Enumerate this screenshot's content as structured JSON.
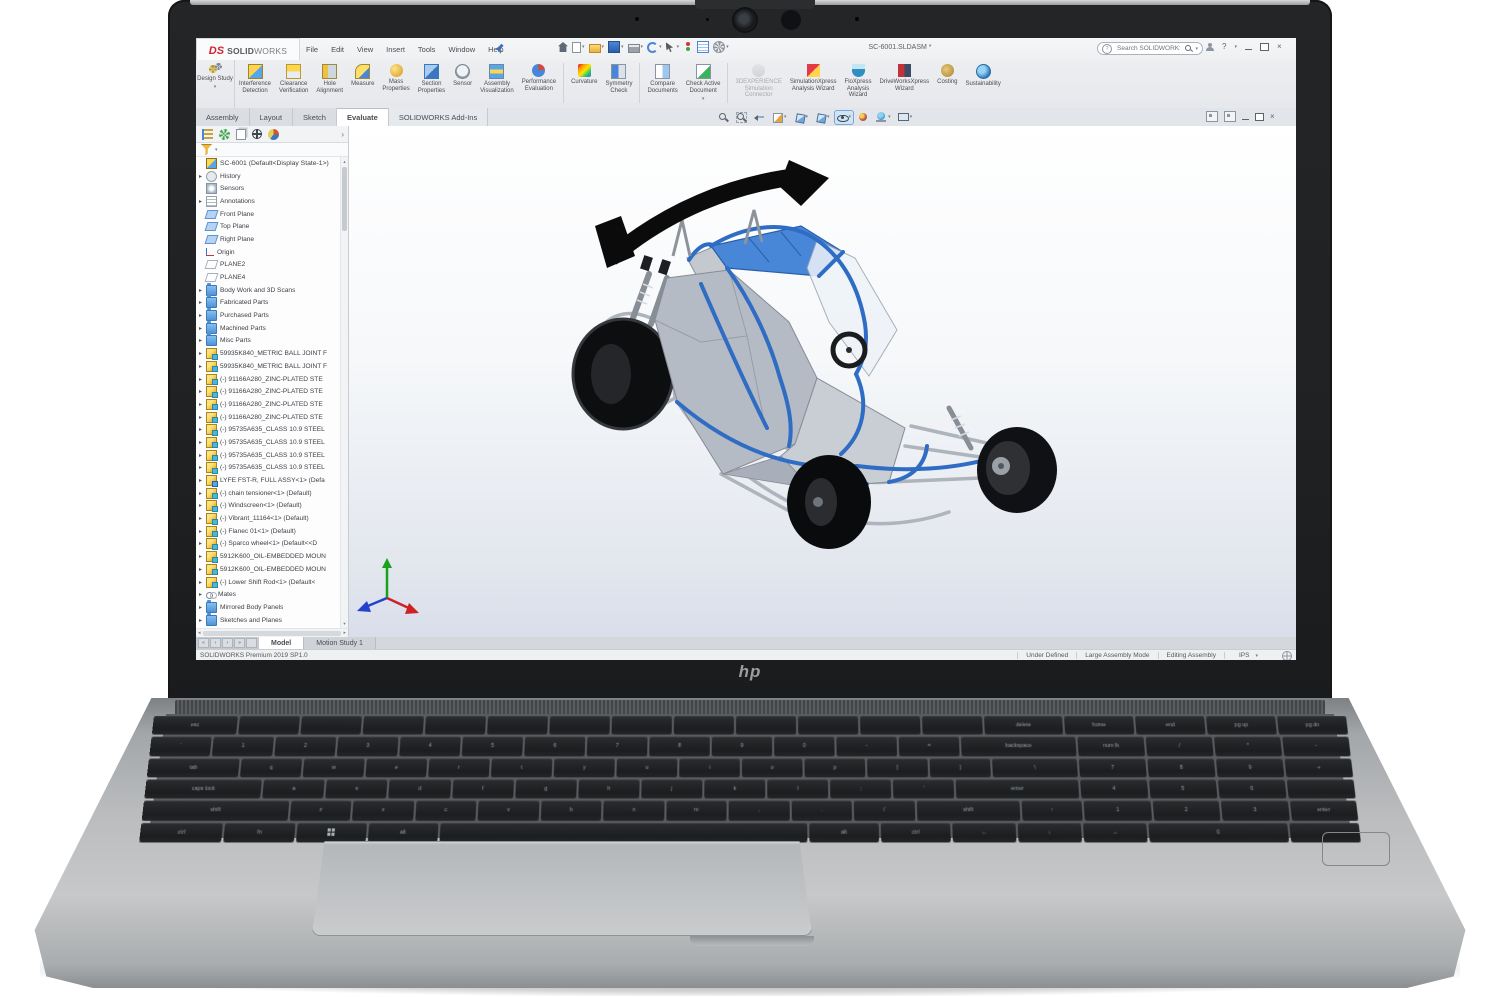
{
  "brand": {
    "ds": "DS",
    "solid": "SOLID",
    "works": "WORKS"
  },
  "title_bar": {
    "menus": [
      "File",
      "Edit",
      "View",
      "Insert",
      "Tools",
      "Window",
      "Help"
    ],
    "quick_access": [
      {
        "name": "home-icon"
      },
      {
        "name": "new-document-icon",
        "dropdown": true
      },
      {
        "name": "open-icon",
        "dropdown": true
      },
      {
        "name": "save-icon",
        "dropdown": true
      },
      {
        "name": "print-icon",
        "dropdown": true
      },
      {
        "name": "undo-icon",
        "dropdown": true
      },
      {
        "name": "select-icon",
        "dropdown": true
      },
      {
        "name": "rebuild-icon"
      },
      {
        "name": "file-properties-icon"
      },
      {
        "name": "options-icon",
        "dropdown": true
      }
    ],
    "document_title": "SC-6001.SLDASM *",
    "search_placeholder": "Search SOLIDWORKS Help"
  },
  "ribbon": {
    "design_study": "Design Study",
    "items": [
      {
        "label": [
          "Interference",
          "Detection"
        ],
        "icon": "interference-detection-icon"
      },
      {
        "label": [
          "Clearance",
          "Verification"
        ],
        "icon": "clearance-verification-icon"
      },
      {
        "label": [
          "Hole",
          "Alignment"
        ],
        "icon": "hole-alignment-icon"
      },
      {
        "label": [
          "Measure"
        ],
        "icon": "measure-icon"
      },
      {
        "label": [
          "Mass",
          "Properties"
        ],
        "icon": "mass-properties-icon"
      },
      {
        "label": [
          "Section",
          "Properties"
        ],
        "icon": "section-properties-icon"
      },
      {
        "label": [
          "Sensor"
        ],
        "icon": "sensor-icon"
      },
      {
        "label": [
          "Assembly",
          "Visualization"
        ],
        "icon": "assembly-visualization-icon"
      },
      {
        "label": [
          "Performance",
          "Evaluation"
        ],
        "icon": "performance-evaluation-icon"
      },
      {
        "sep": true
      },
      {
        "label": [
          "Curvature"
        ],
        "icon": "curvature-icon"
      },
      {
        "label": [
          "Symmetry",
          "Check"
        ],
        "icon": "symmetry-check-icon"
      },
      {
        "sep": true
      },
      {
        "label": [
          "Compare",
          "Documents"
        ],
        "icon": "compare-documents-icon"
      },
      {
        "label": [
          "Check Active",
          "Document"
        ],
        "icon": "check-active-document-icon",
        "dropdown": true
      },
      {
        "sep": true
      },
      {
        "label": [
          "3DEXPERIENCE",
          "Simulation",
          "Connector"
        ],
        "icon": "3dexperience-simulation-connector-icon",
        "disabled": true
      },
      {
        "label": [
          "SimulationXpress",
          "Analysis Wizard"
        ],
        "icon": "simulationxpress-wizard-icon"
      },
      {
        "label": [
          "FloXpress",
          "Analysis",
          "Wizard"
        ],
        "icon": "floxpress-wizard-icon"
      },
      {
        "label": [
          "DriveWorksXpress",
          "Wizard"
        ],
        "icon": "driveworksxpress-wizard-icon"
      },
      {
        "label": [
          "Costing"
        ],
        "icon": "costing-icon"
      },
      {
        "label": [
          "Sustainability"
        ],
        "icon": "sustainability-icon"
      }
    ]
  },
  "command_tabs": {
    "items": [
      "Assembly",
      "Layout",
      "Sketch",
      "Evaluate",
      "SOLIDWORKS Add-Ins"
    ],
    "active": "Evaluate"
  },
  "viewport": {
    "hud": [
      {
        "name": "zoom-to-fit-icon"
      },
      {
        "name": "zoom-to-area-icon"
      },
      {
        "name": "previous-view-icon"
      },
      {
        "name": "section-view-icon",
        "dropdown": true
      },
      {
        "name": "view-orientation-icon",
        "dropdown": true
      },
      {
        "name": "display-style-icon",
        "dropdown": true
      },
      {
        "name": "hide-show-items-icon",
        "dropdown": true,
        "selected": true
      },
      {
        "name": "edit-appearance-icon"
      },
      {
        "name": "apply-scene-icon",
        "dropdown": true
      },
      {
        "name": "view-settings-icon",
        "dropdown": true
      }
    ]
  },
  "feature_panel": {
    "tabs": [
      {
        "name": "featuremanager-tree-tab-icon"
      },
      {
        "name": "propertymanager-tab-icon"
      },
      {
        "name": "configurationmanager-tab-icon"
      },
      {
        "name": "dimxpertmanager-tab-icon"
      },
      {
        "name": "displaymanager-tab-icon"
      }
    ],
    "root": "SC-6001  (Default<Display State-1>)",
    "items": [
      {
        "label": "History",
        "icon": "history-icon",
        "expand": true
      },
      {
        "label": "Sensors",
        "icon": "sensors-icon"
      },
      {
        "label": "Annotations",
        "icon": "annotations-icon",
        "expand": true
      },
      {
        "label": "Front Plane",
        "icon": "plane-icon"
      },
      {
        "label": "Top Plane",
        "icon": "plane-icon"
      },
      {
        "label": "Right Plane",
        "icon": "plane-icon"
      },
      {
        "label": "Origin",
        "icon": "origin-icon"
      },
      {
        "label": "PLANE2",
        "icon": "ref-plane-icon"
      },
      {
        "label": "PLANE4",
        "icon": "ref-plane-icon"
      },
      {
        "label": "Body Work and 3D Scans",
        "icon": "folder-icon",
        "expand": true
      },
      {
        "label": "Fabricated Parts",
        "icon": "folder-icon",
        "expand": true
      },
      {
        "label": "Purchased Parts",
        "icon": "folder-icon",
        "expand": true
      },
      {
        "label": "Machined Parts",
        "icon": "folder-icon",
        "expand": true
      },
      {
        "label": "Misc Parts",
        "icon": "folder-icon",
        "expand": true
      },
      {
        "label": "59935K840_METRIC BALL JOINT F",
        "icon": "part-icon",
        "expand": true
      },
      {
        "label": "59935K840_METRIC BALL JOINT F",
        "icon": "part-icon",
        "expand": true
      },
      {
        "label": "(-) 91166A280_ZINC-PLATED STE",
        "icon": "part-icon",
        "expand": true
      },
      {
        "label": "(-) 91166A280_ZINC-PLATED STE",
        "icon": "part-icon",
        "expand": true
      },
      {
        "label": "(-) 91166A280_ZINC-PLATED STE",
        "icon": "part-icon",
        "expand": true
      },
      {
        "label": "(-) 91166A280_ZINC-PLATED STE",
        "icon": "part-icon",
        "expand": true
      },
      {
        "label": "(-) 95735A635_CLASS 10.9 STEEL",
        "icon": "part-icon",
        "expand": true
      },
      {
        "label": "(-) 95735A635_CLASS 10.9 STEEL",
        "icon": "part-icon",
        "expand": true
      },
      {
        "label": "(-) 95735A635_CLASS 10.9 STEEL",
        "icon": "part-icon",
        "expand": true
      },
      {
        "label": "(-) 95735A635_CLASS 10.9 STEEL",
        "icon": "part-icon",
        "expand": true
      },
      {
        "label": "LYFE FST-R, FULL ASSY<1> (Defa",
        "icon": "subassembly-icon",
        "expand": true
      },
      {
        "label": "(-) chain tensioner<1> (Default)",
        "icon": "part-icon",
        "expand": true
      },
      {
        "label": "(-) Windscreen<1> (Default)",
        "icon": "part-icon",
        "expand": true
      },
      {
        "label": "(-) Vibrant_11164<1> (Default)",
        "icon": "part-icon",
        "expand": true
      },
      {
        "label": "(-) Flanec 01<1> (Default)",
        "icon": "part-icon",
        "expand": true
      },
      {
        "label": "(-) Sparco wheel<1> (Default<<D",
        "icon": "part-icon",
        "expand": true
      },
      {
        "label": "5912K600_OIL-EMBEDDED MOUN",
        "icon": "part-icon",
        "expand": true
      },
      {
        "label": "5912K600_OIL-EMBEDDED MOUN",
        "icon": "part-icon",
        "expand": true
      },
      {
        "label": "(-) Lower Shift Rod<1> (Default<",
        "icon": "part-icon",
        "expand": true
      },
      {
        "label": "Mates",
        "icon": "mates-icon",
        "expand": true
      },
      {
        "label": "Mirrored Body Panels",
        "icon": "folder-icon",
        "expand": true
      },
      {
        "label": "Sketches and Planes",
        "icon": "folder-icon",
        "expand": true
      }
    ]
  },
  "doc_bar": {
    "tabs": [
      "Model",
      "Motion Study 1"
    ],
    "active": "Model"
  },
  "status_bar": {
    "product": "SOLIDWORKS Premium 2019 SP1.0",
    "segments": [
      "Under Defined",
      "Large Assembly Mode",
      "Editing Assembly"
    ],
    "units": "IPS"
  },
  "laptop": {
    "logo": "hp"
  },
  "keyboard": {
    "rows": [
      [
        [
          "esc",
          1.4
        ],
        [
          "",
          1
        ],
        [
          "",
          1
        ],
        [
          "",
          1
        ],
        [
          "",
          1
        ],
        [
          "",
          1
        ],
        [
          "",
          1
        ],
        [
          "",
          1
        ],
        [
          "",
          1
        ],
        [
          "",
          1
        ],
        [
          "",
          1
        ],
        [
          "",
          1
        ],
        [
          "",
          1
        ],
        [
          "delete",
          1.3
        ],
        [
          "home",
          1.15
        ],
        [
          "end",
          1.15
        ],
        [
          "pg up",
          1.15
        ],
        [
          "pg dn",
          1.15
        ]
      ],
      [
        [
          "`",
          1
        ],
        [
          "1",
          1
        ],
        [
          "2",
          1
        ],
        [
          "3",
          1
        ],
        [
          "4",
          1
        ],
        [
          "5",
          1
        ],
        [
          "6",
          1
        ],
        [
          "7",
          1
        ],
        [
          "8",
          1
        ],
        [
          "9",
          1
        ],
        [
          "0",
          1
        ],
        [
          "-",
          1
        ],
        [
          "=",
          1
        ],
        [
          "backspace",
          1.9
        ],
        [
          "num lk",
          1.1
        ],
        [
          "/",
          1.1
        ],
        [
          "*",
          1.1
        ],
        [
          "-",
          1.1
        ]
      ],
      [
        [
          "tab",
          1.5
        ],
        [
          "q",
          1
        ],
        [
          "w",
          1
        ],
        [
          "e",
          1
        ],
        [
          "r",
          1
        ],
        [
          "t",
          1
        ],
        [
          "y",
          1
        ],
        [
          "u",
          1
        ],
        [
          "i",
          1
        ],
        [
          "o",
          1
        ],
        [
          "p",
          1
        ],
        [
          "[",
          1
        ],
        [
          "]",
          1
        ],
        [
          "\\",
          1.4
        ],
        [
          "7",
          1.1
        ],
        [
          "8",
          1.1
        ],
        [
          "9",
          1.1
        ],
        [
          "+",
          1.1
        ]
      ],
      [
        [
          "caps lock",
          1.9
        ],
        [
          "a",
          1
        ],
        [
          "s",
          1
        ],
        [
          "d",
          1
        ],
        [
          "f",
          1
        ],
        [
          "g",
          1
        ],
        [
          "h",
          1
        ],
        [
          "j",
          1
        ],
        [
          "k",
          1
        ],
        [
          "l",
          1
        ],
        [
          ";",
          1
        ],
        [
          "'",
          1
        ],
        [
          "enter",
          2.0
        ],
        [
          "4",
          1.1
        ],
        [
          "5",
          1.1
        ],
        [
          "6",
          1.1
        ],
        [
          "",
          1.1
        ]
      ],
      [
        [
          "shift",
          2.4
        ],
        [
          "z",
          1
        ],
        [
          "x",
          1
        ],
        [
          "c",
          1
        ],
        [
          "v",
          1
        ],
        [
          "b",
          1
        ],
        [
          "n",
          1
        ],
        [
          "m",
          1
        ],
        [
          ",",
          1
        ],
        [
          ".",
          1
        ],
        [
          "/",
          1
        ],
        [
          "shift",
          1.7
        ],
        [
          "↑",
          1
        ],
        [
          "1",
          1.1
        ],
        [
          "2",
          1.1
        ],
        [
          "3",
          1.1
        ],
        [
          "enter",
          1.1
        ]
      ],
      [
        [
          "ctrl",
          1.3
        ],
        [
          "fn",
          1.1
        ],
        [
          "win",
          1.1
        ],
        [
          "alt",
          1.1
        ],
        [
          "",
          5.8
        ],
        [
          "alt",
          1.1
        ],
        [
          "ctrl",
          1.1
        ],
        [
          "←",
          1
        ],
        [
          "↓",
          1
        ],
        [
          "→",
          1
        ],
        [
          "0",
          2.2
        ],
        [
          ".",
          1.1
        ]
      ]
    ]
  },
  "glyphs": {
    "dropdown": "▾",
    "expand": "▸",
    "scroll_up": "▴",
    "scroll_down": "▾",
    "scroll_left": "◂",
    "scroll_right": "▸",
    "tab_first": "«",
    "tab_prev": "‹",
    "tab_next": "›",
    "tab_last": "»",
    "close": "×",
    "question": "?",
    "chevron_right": "›"
  }
}
